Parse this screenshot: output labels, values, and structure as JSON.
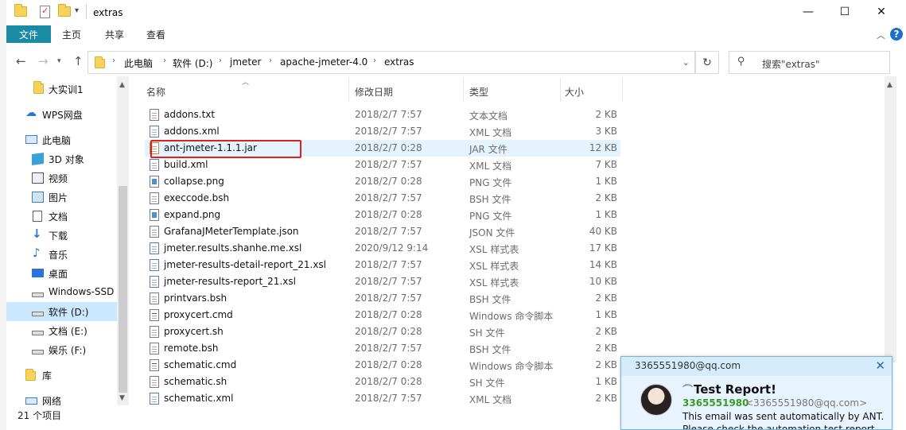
{
  "window": {
    "title": "extras",
    "minimize": "—",
    "maximize": "☐",
    "close": "✕"
  },
  "ribbon": {
    "tabs": [
      "文件",
      "主页",
      "共享",
      "查看"
    ],
    "help": "?"
  },
  "address": {
    "crumbs": [
      "此电脑",
      "软件 (D:)",
      "jmeter",
      "apache-jmeter-4.0",
      "extras"
    ],
    "search_placeholder": "搜索\"extras\""
  },
  "columns": {
    "name": "名称",
    "date": "修改日期",
    "type": "类型",
    "size": "大小"
  },
  "navpane": {
    "items": [
      {
        "label": "大实训1",
        "icon": "folder-icon"
      },
      {
        "label": "WPS网盘",
        "icon": "cloud-icon"
      },
      {
        "label": "此电脑",
        "icon": "computer-icon"
      },
      {
        "label": "3D 对象",
        "icon": "3d-objects-icon"
      },
      {
        "label": "视频",
        "icon": "video-icon"
      },
      {
        "label": "图片",
        "icon": "pictures-icon"
      },
      {
        "label": "文档",
        "icon": "documents-icon"
      },
      {
        "label": "下载",
        "icon": "download-icon"
      },
      {
        "label": "音乐",
        "icon": "music-icon"
      },
      {
        "label": "桌面",
        "icon": "desktop-icon"
      },
      {
        "label": "Windows-SSD",
        "icon": "drive-icon"
      },
      {
        "label": "软件 (D:)",
        "icon": "drive-icon"
      },
      {
        "label": "文档 (E:)",
        "icon": "drive-icon"
      },
      {
        "label": "娱乐 (F:)",
        "icon": "drive-icon"
      },
      {
        "label": "库",
        "icon": "library-icon"
      },
      {
        "label": "网络",
        "icon": "network-icon"
      }
    ],
    "selected": "软件 (D:)"
  },
  "files": [
    {
      "name": "addons.txt",
      "date": "2018/2/7 7:57",
      "type": "文本文档",
      "size": "2 KB",
      "icon": "text-file-icon"
    },
    {
      "name": "addons.xml",
      "date": "2018/2/7 7:57",
      "type": "XML 文档",
      "size": "3 KB",
      "icon": "xml-file-icon"
    },
    {
      "name": "ant-jmeter-1.1.1.jar",
      "date": "2018/2/7 0:28",
      "type": "JAR 文件",
      "size": "12 KB",
      "icon": "jar-file-icon"
    },
    {
      "name": "build.xml",
      "date": "2018/2/7 7:57",
      "type": "XML 文档",
      "size": "7 KB",
      "icon": "xml-file-icon"
    },
    {
      "name": "collapse.png",
      "date": "2018/2/7 0:28",
      "type": "PNG 文件",
      "size": "1 KB",
      "icon": "image-file-icon"
    },
    {
      "name": "execcode.bsh",
      "date": "2018/2/7 7:57",
      "type": "BSH 文件",
      "size": "2 KB",
      "icon": "file-icon"
    },
    {
      "name": "expand.png",
      "date": "2018/2/7 0:28",
      "type": "PNG 文件",
      "size": "1 KB",
      "icon": "image-file-icon"
    },
    {
      "name": "GrafanaJMeterTemplate.json",
      "date": "2018/2/7 7:57",
      "type": "JSON 文件",
      "size": "40 KB",
      "icon": "file-icon"
    },
    {
      "name": "jmeter.results.shanhe.me.xsl",
      "date": "2020/9/12 9:14",
      "type": "XSL 样式表",
      "size": "17 KB",
      "icon": "xsl-file-icon"
    },
    {
      "name": "jmeter-results-detail-report_21.xsl",
      "date": "2018/2/7 7:57",
      "type": "XSL 样式表",
      "size": "14 KB",
      "icon": "xsl-file-icon"
    },
    {
      "name": "jmeter-results-report_21.xsl",
      "date": "2018/2/7 7:57",
      "type": "XSL 样式表",
      "size": "10 KB",
      "icon": "xsl-file-icon"
    },
    {
      "name": "printvars.bsh",
      "date": "2018/2/7 7:57",
      "type": "BSH 文件",
      "size": "2 KB",
      "icon": "file-icon"
    },
    {
      "name": "proxycert.cmd",
      "date": "2018/2/7 0:28",
      "type": "Windows 命令脚本",
      "size": "1 KB",
      "icon": "cmd-file-icon"
    },
    {
      "name": "proxycert.sh",
      "date": "2018/2/7 0:28",
      "type": "SH 文件",
      "size": "2 KB",
      "icon": "file-icon"
    },
    {
      "name": "remote.bsh",
      "date": "2018/2/7 7:57",
      "type": "BSH 文件",
      "size": "2 KB",
      "icon": "file-icon"
    },
    {
      "name": "schematic.cmd",
      "date": "2018/2/7 0:28",
      "type": "Windows 命令脚本",
      "size": "2 KB",
      "icon": "cmd-file-icon"
    },
    {
      "name": "schematic.sh",
      "date": "2018/2/7 0:28",
      "type": "SH 文件",
      "size": "1 KB",
      "icon": "file-icon"
    },
    {
      "name": "schematic.xml",
      "date": "2018/2/7 7:57",
      "type": "XML 文档",
      "size": "2 KB",
      "icon": "xml-file-icon"
    }
  ],
  "highlighted_file": "ant-jmeter-1.1.1.jar",
  "status": {
    "item_count": "21 个项目"
  },
  "notification": {
    "sender_email": "3365551980@qq.com",
    "subject": "Test Report!",
    "sender_number": "3365551980",
    "sender_addr": "<3365551980@qq.com>",
    "message_line1": "This email was sent automatically by ANT.",
    "message_line2": "Please check the automation test report"
  },
  "colors": {
    "accent": "#1a8aa5",
    "selection": "#cce8ff",
    "highlight_border": "#e02020",
    "notification_header": "#d7ecfb"
  }
}
